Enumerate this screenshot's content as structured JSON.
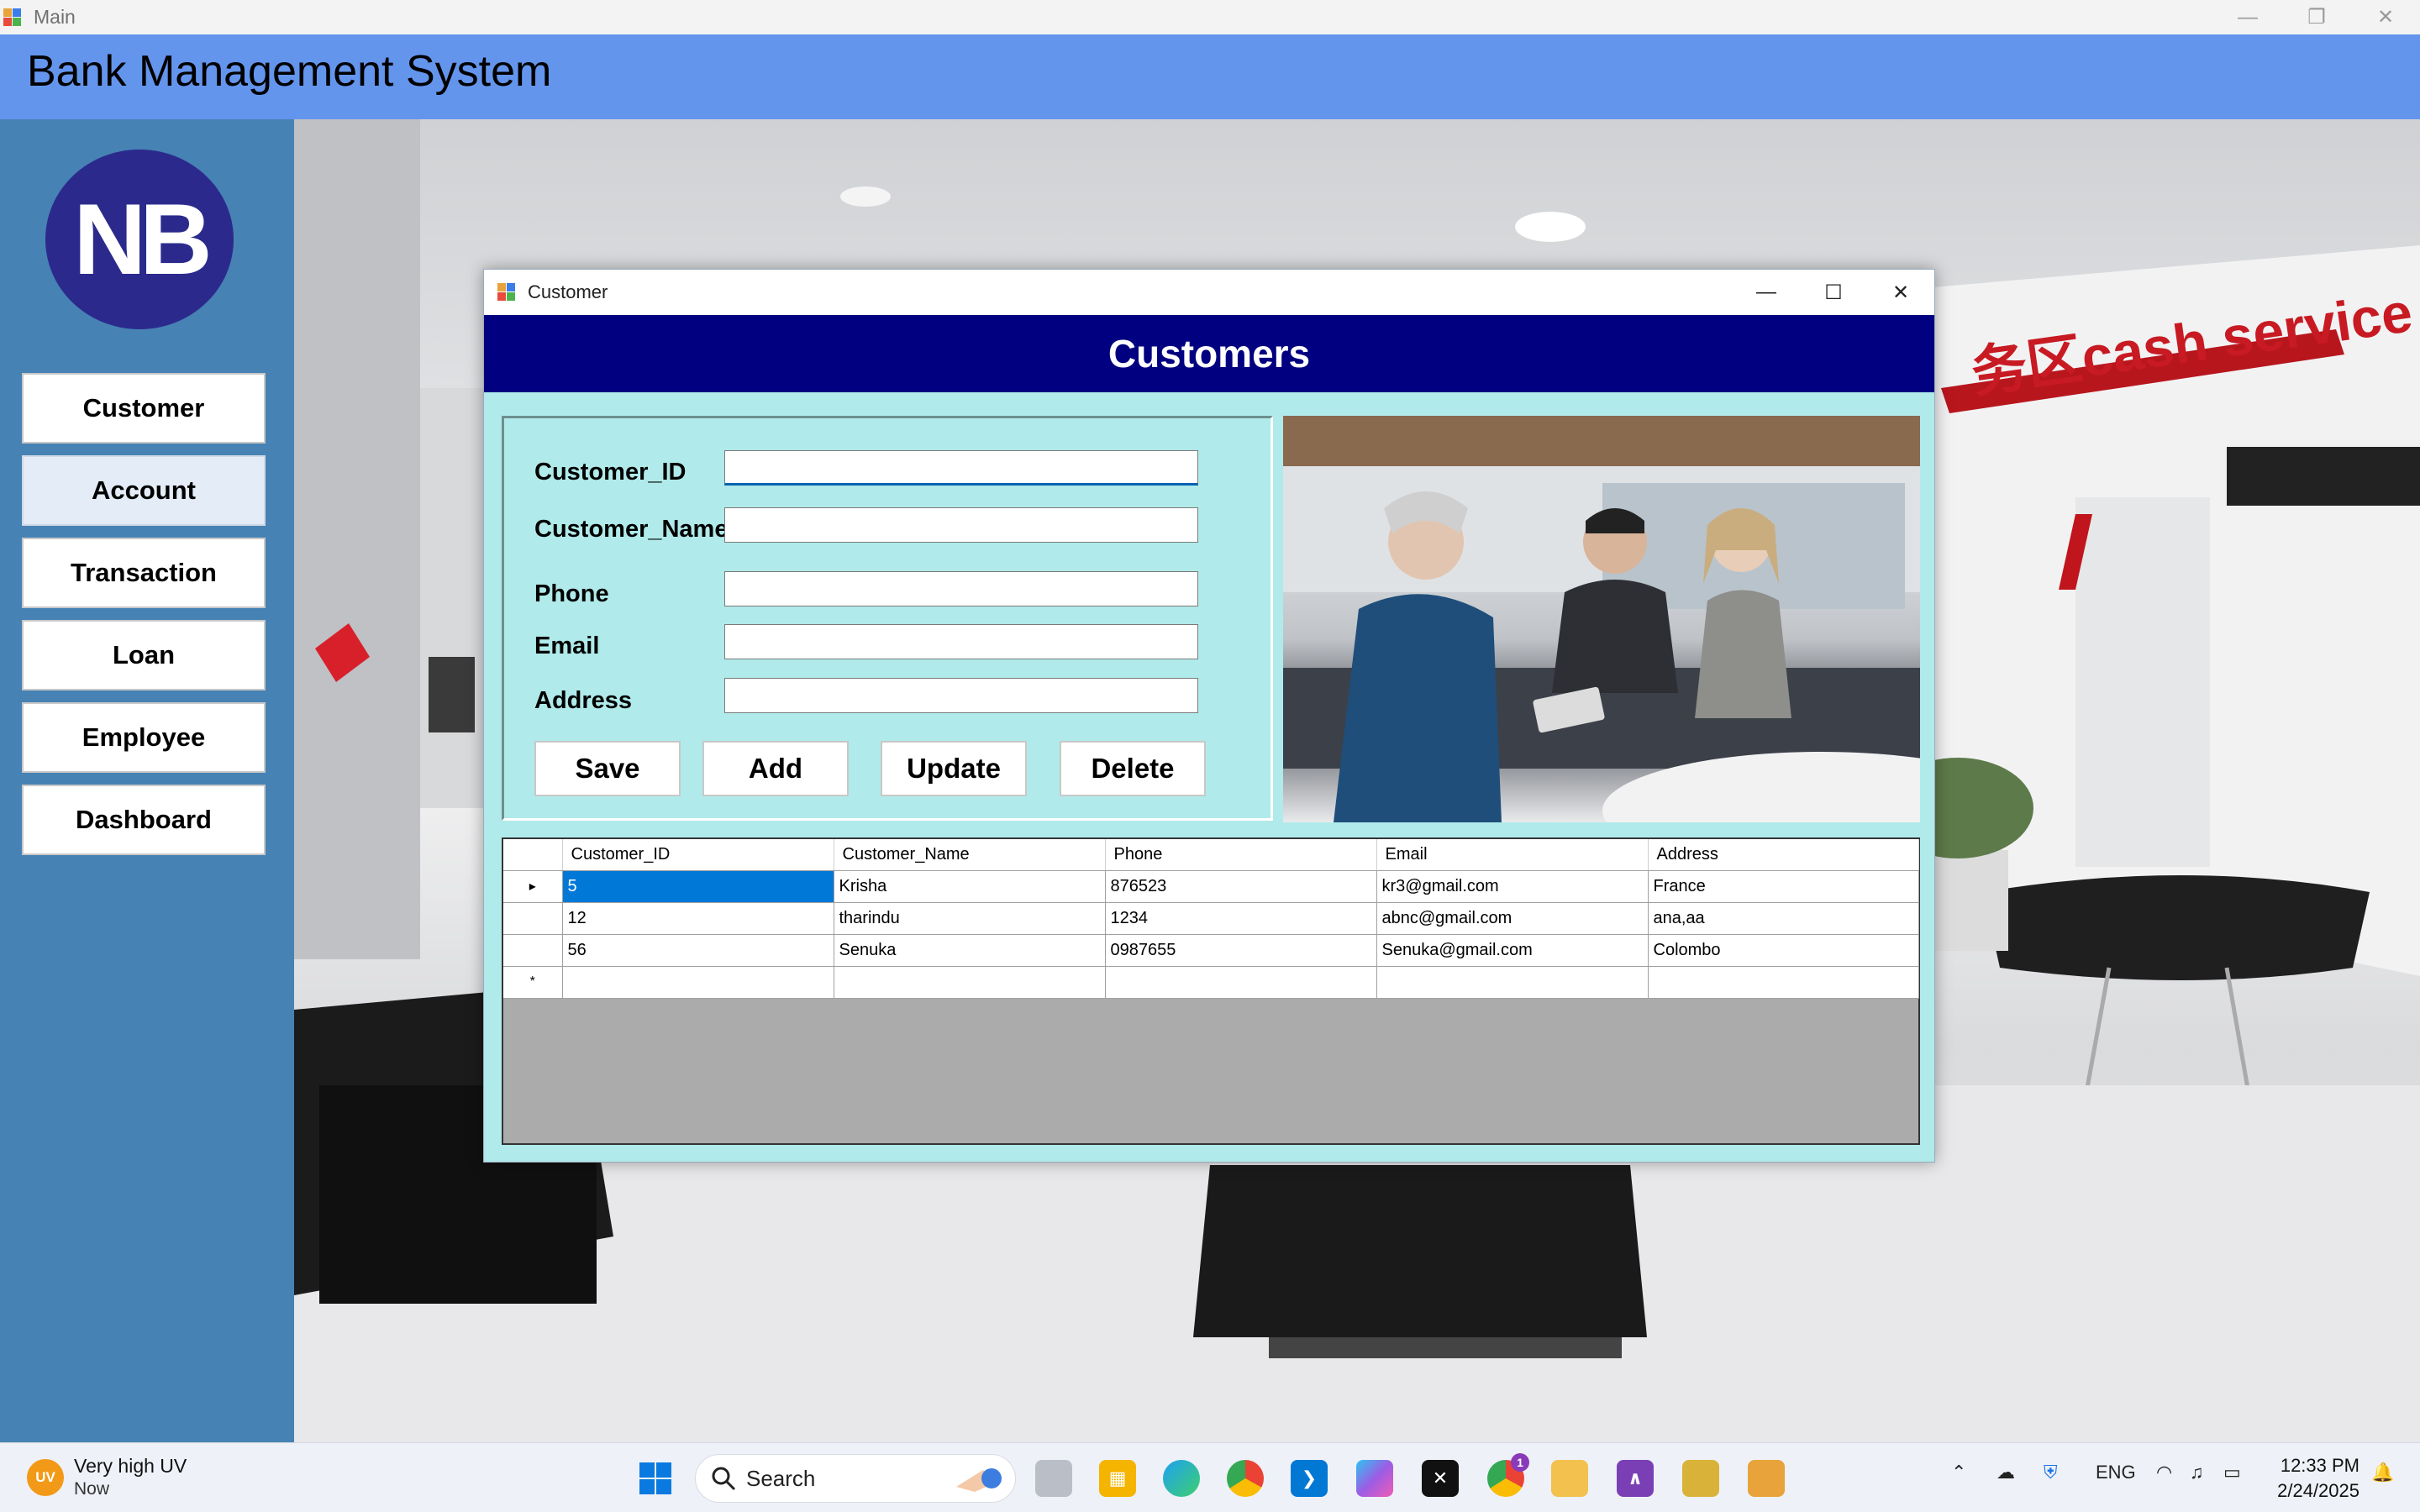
{
  "main_window": {
    "title": "Main"
  },
  "header": {
    "title": "Bank Management System"
  },
  "logo": {
    "text": "NB"
  },
  "sidebar": {
    "items": [
      {
        "label": "Customer"
      },
      {
        "label": "Account"
      },
      {
        "label": "Transaction"
      },
      {
        "label": "Loan"
      },
      {
        "label": "Employee"
      },
      {
        "label": "Dashboard"
      }
    ]
  },
  "background_scene": {
    "sign_text": "务区cash service"
  },
  "customer_window": {
    "title": "Customer",
    "banner": "Customers",
    "fields": [
      {
        "label": "Customer_ID",
        "value": ""
      },
      {
        "label": "Customer_Name",
        "value": ""
      },
      {
        "label": "Phone",
        "value": ""
      },
      {
        "label": "Email",
        "value": ""
      },
      {
        "label": "Address",
        "value": ""
      }
    ],
    "buttons": {
      "save": "Save",
      "add": "Add",
      "update": "Update",
      "delete": "Delete"
    },
    "grid": {
      "columns": [
        "Customer_ID",
        "Customer_Name",
        "Phone",
        "Email",
        "Address"
      ],
      "rows": [
        [
          "5",
          "Krisha",
          "876523",
          "kr3@gmail.com",
          "France"
        ],
        [
          "12",
          "tharindu",
          "1234",
          "abnc@gmail.com",
          "ana,aa"
        ],
        [
          "56",
          "Senuka",
          "0987655",
          "Senuka@gmail.com",
          "Colombo"
        ]
      ],
      "current_row_marker": "▸",
      "new_row_marker": "*"
    }
  },
  "taskbar": {
    "weather": {
      "badge": "UV",
      "line1": "Very high UV",
      "line2": "Now"
    },
    "search_label": "Search",
    "tray": {
      "language": "ENG",
      "time": "12:33 PM",
      "date": "2/24/2025",
      "chrome_badge": "1"
    }
  },
  "colors": {
    "header": "#6495ed",
    "sidebar": "#4682b4",
    "banner": "#000080",
    "form_bg": "#b0eaea",
    "selection": "#0078d7",
    "logo": "#2b2a8c"
  }
}
